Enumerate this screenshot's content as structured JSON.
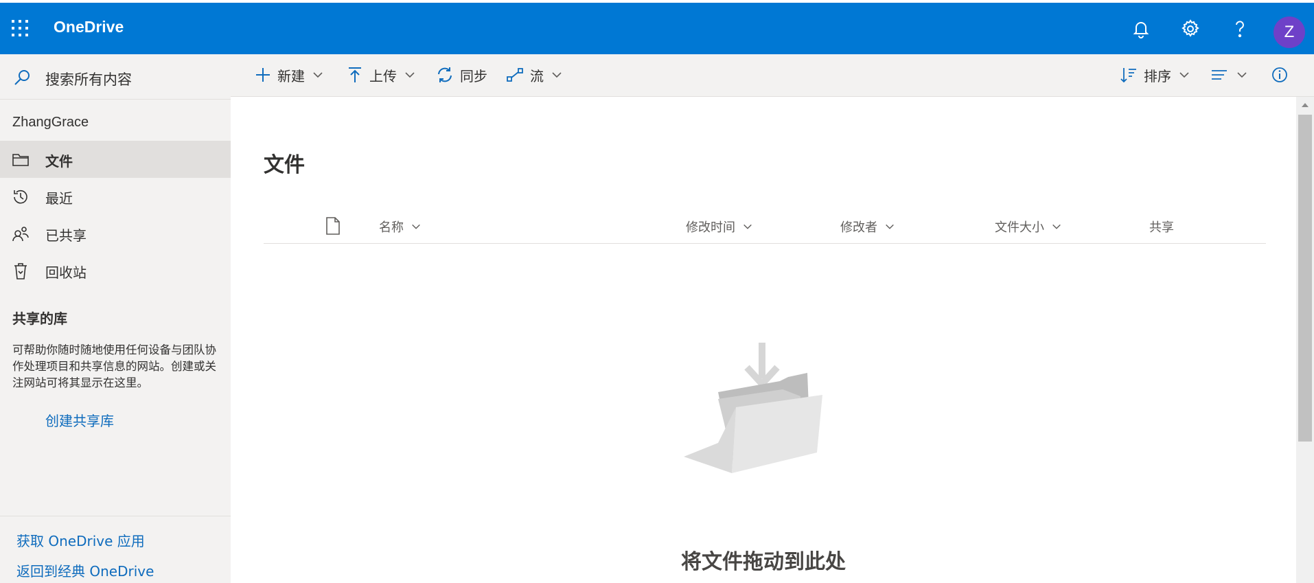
{
  "header": {
    "app_name": "OneDrive",
    "avatar_initial": "Z",
    "brand_color": "#0078d4",
    "avatar_color": "#6e41c8",
    "icons": [
      "waffle-icon",
      "bell-icon",
      "gear-icon",
      "help-icon"
    ]
  },
  "sidebar": {
    "search_placeholder": "搜索所有内容",
    "user_name": "ZhangGrace",
    "items": [
      {
        "label": "文件",
        "icon": "folder-icon",
        "active": true
      },
      {
        "label": "最近",
        "icon": "history-icon",
        "active": false
      },
      {
        "label": "已共享",
        "icon": "people-icon",
        "active": false
      },
      {
        "label": "回收站",
        "icon": "recycle-bin-icon",
        "active": false
      }
    ],
    "shared_libraries": {
      "title": "共享的库",
      "description": "可帮助你随时随地使用任何设备与团队协作处理项目和共享信息的网站。创建或关注网站可将其显示在这里。",
      "create_link": "创建共享库"
    },
    "footer": {
      "get_app": "获取 OneDrive 应用",
      "classic": "返回到经典 OneDrive"
    }
  },
  "command_bar": {
    "new": "新建",
    "upload": "上传",
    "sync": "同步",
    "flow": "流",
    "sort": "排序"
  },
  "main": {
    "title": "文件",
    "columns": {
      "name": "名称",
      "modified": "修改时间",
      "modified_by": "修改者",
      "file_size": "文件大小",
      "sharing": "共享"
    },
    "empty_state": "将文件拖动到此处"
  }
}
